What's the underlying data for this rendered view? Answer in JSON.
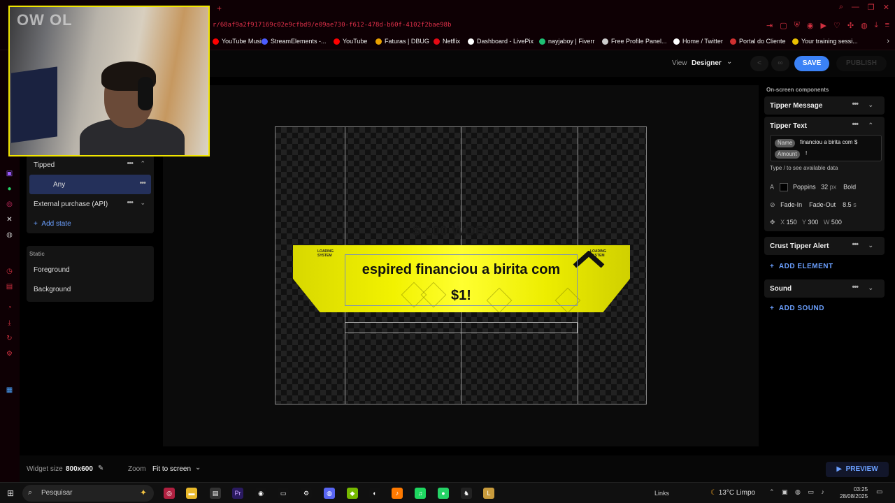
{
  "browser": {
    "url": "r/68af9a2f917169c02e9cfbd9/e09ae730-f612-478d-b60f-4102f2bae98b",
    "bookmarks": [
      {
        "label": "YouTube Music",
        "color": "#ff0000"
      },
      {
        "label": "StreamElements -...",
        "color": "#4b5cff"
      },
      {
        "label": "YouTube",
        "color": "#ff0000"
      },
      {
        "label": "Faturas | DBUG",
        "color": "#e9a100"
      },
      {
        "label": "Netflix",
        "color": "#e50914"
      },
      {
        "label": "Dashboard - LivePix",
        "color": "#ffffff"
      },
      {
        "label": "nayjaboy | Fiverr",
        "color": "#1dbf73"
      },
      {
        "label": "Free Profile Panel...",
        "color": "#cccccc"
      },
      {
        "label": "Home / Twitter",
        "color": "#ffffff"
      },
      {
        "label": "Portal do Cliente",
        "color": "#d03030"
      },
      {
        "label": "Your training sessi...",
        "color": "#e9c000"
      }
    ]
  },
  "header": {
    "view_label": "View",
    "view_value": "Designer",
    "save_label": "SAVE",
    "publish_label": "PUBLISH"
  },
  "left_panel": {
    "states": [
      {
        "label": "Tipped"
      },
      {
        "label": "Any"
      },
      {
        "label": "External purchase (API)"
      }
    ],
    "add_state_label": "Add state",
    "static_label": "Static",
    "static_items": [
      {
        "label": "Foreground"
      },
      {
        "label": "Background"
      }
    ]
  },
  "canvas": {
    "ghost_title": "$ 100 WORK",
    "loading_tag": "LOADING\nSYSTEM",
    "alert_line1": "espired financiou a birita com",
    "alert_line2": "$1!"
  },
  "right_panel": {
    "title": "On-screen components",
    "tipper_message": "Tipper Message",
    "tipper_text": "Tipper Text",
    "chip_name": "Name",
    "after_name": "financiou a birita com $",
    "chip_amount": "Amount",
    "after_amount": "!",
    "type_hint": "Type / to see available data",
    "font": "Poppins",
    "font_size": "32",
    "font_unit": "px",
    "font_weight": "Bold",
    "text_color": "#000000",
    "fade_in": "Fade-In",
    "fade_out": "Fade-Out",
    "duration": "8.5",
    "duration_unit": "s",
    "x_label": "X",
    "x_value": "150",
    "y_label": "Y",
    "y_value": "300",
    "w_label": "W",
    "w_value": "500",
    "crust_alert": "Crust Tipper Alert",
    "add_element": "ADD ELEMENT",
    "sound": "Sound",
    "add_sound": "ADD SOUND"
  },
  "bottom_bar": {
    "widget_size_label": "Widget size",
    "widget_size_value": "800x600",
    "zoom_label": "Zoom",
    "zoom_value": "Fit to screen",
    "preview_label": "PREVIEW"
  },
  "taskbar": {
    "search_placeholder": "Pesquisar",
    "links_label": "Links",
    "weather": "13°C  Limpo",
    "time": "03:25",
    "date": "28/08/2025"
  },
  "webcam": {
    "caption": "OW OL"
  },
  "colors": {
    "accent": "#3b82f6",
    "link": "#6ba0ff",
    "alert_yellow": "#f2f200",
    "cam_border": "#f2e600"
  }
}
